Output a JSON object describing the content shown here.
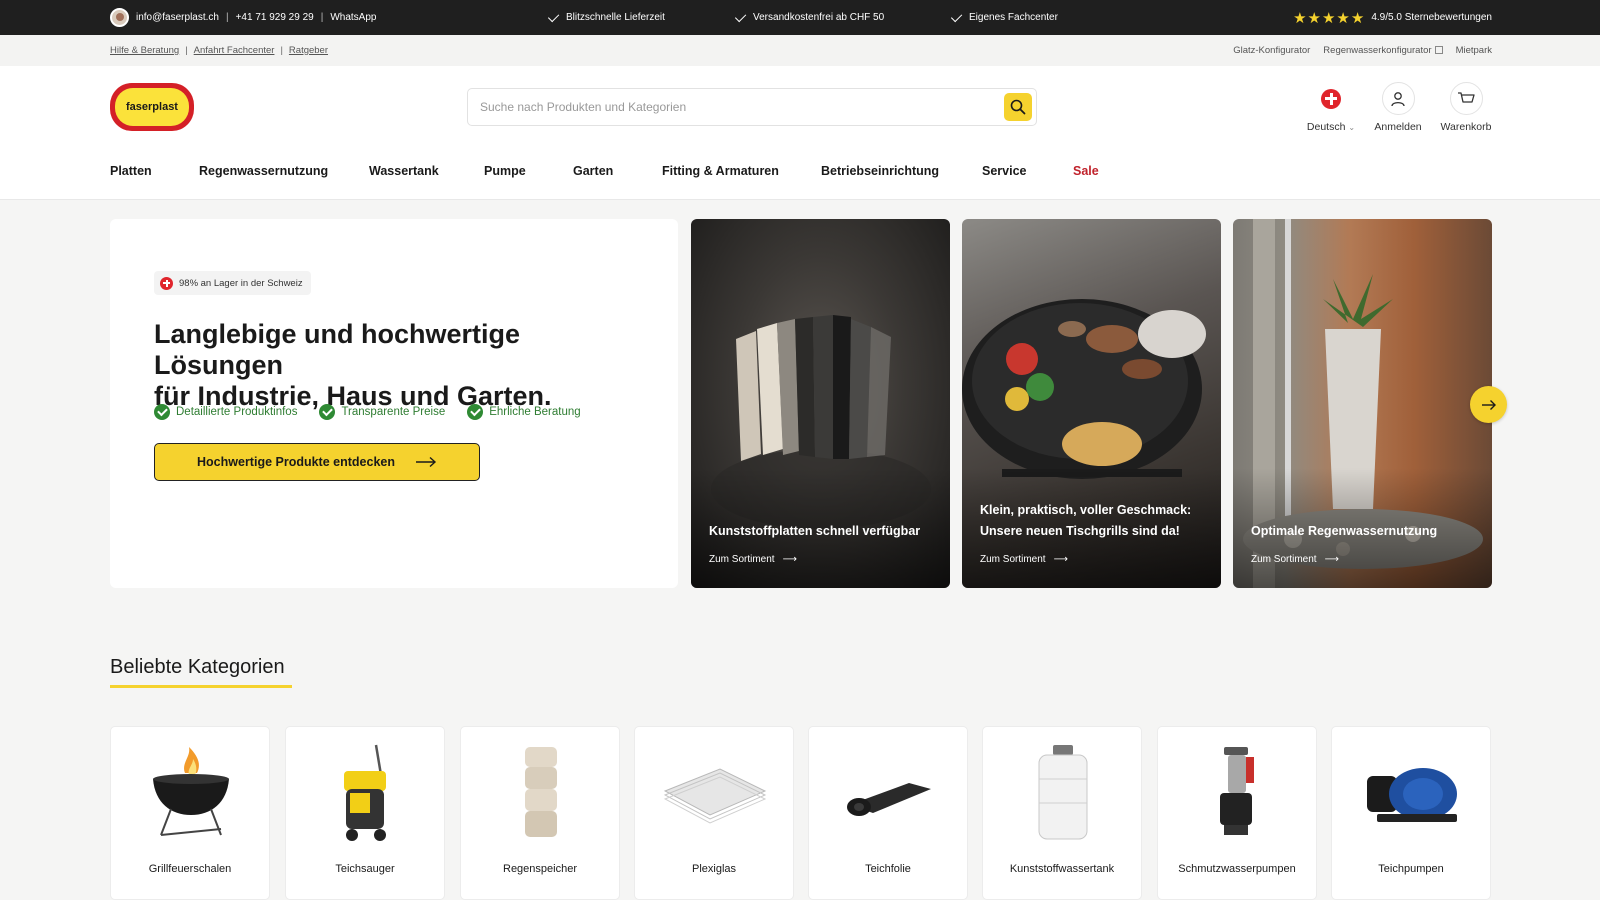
{
  "topbar": {
    "email": "info@faserplast.ch",
    "phone": "+41 71 929 29 29",
    "whatsapp": "WhatsApp",
    "usps": [
      "Blitzschnelle Lieferzeit",
      "Versandkostenfrei ab CHF 50",
      "Eigenes Fachcenter"
    ],
    "stars": "★★★★★",
    "rating_text": "4.9/5.0 Sternebewertungen"
  },
  "utility": {
    "left_links": [
      "Hilfe & Beratung",
      "Anfahrt Fachcenter",
      "Ratgeber"
    ],
    "right_links": [
      "Glatz-Konfigurator",
      "Regenwasserkonfigurator",
      "Mietpark"
    ]
  },
  "header": {
    "logo_text": "faserplast",
    "search_placeholder": "Suche nach Produkten und Kategorien",
    "language_label": "Deutsch",
    "login_label": "Anmelden",
    "cart_label": "Warenkorb"
  },
  "nav": [
    "Platten",
    "Regenwassernutzung",
    "Wassertank",
    "Pumpe",
    "Garten",
    "Fitting & Armaturen",
    "Betriebseinrichtung",
    "Service",
    "Sale"
  ],
  "hero": {
    "badge": "98% an Lager in der Schweiz",
    "title_line1": "Langlebige und hochwertige Lösungen",
    "title_line2": "für Industrie, Haus und Garten.",
    "points": [
      "Detaillierte Produktinfos",
      "Transparente Preise",
      "Ehrliche Beratung"
    ],
    "cta": "Hochwertige Produkte entdecken"
  },
  "promos": [
    {
      "title": "Kunststoffplatten schnell verfügbar",
      "link": "Zum Sortiment"
    },
    {
      "title": "Klein, praktisch, voller Geschmack: Unsere neuen Tischgrills sind da!",
      "link": "Zum Sortiment"
    },
    {
      "title": "Optimale Regenwassernutzung",
      "link": "Zum Sortiment"
    }
  ],
  "categories": {
    "title": "Beliebte Kategorien",
    "items": [
      "Grillfeuerschalen",
      "Teichsauger",
      "Regenspeicher",
      "Plexiglas",
      "Teichfolie",
      "Kunststoffwassertank",
      "Schmutzwasserpumpen",
      "Teichpumpen"
    ]
  },
  "colors": {
    "brand_yellow": "#f5d22e",
    "brand_red": "#d42027",
    "sale_red": "#c0222b",
    "accent_green": "#2f8a34",
    "topbar_bg": "#1f1f1f"
  }
}
